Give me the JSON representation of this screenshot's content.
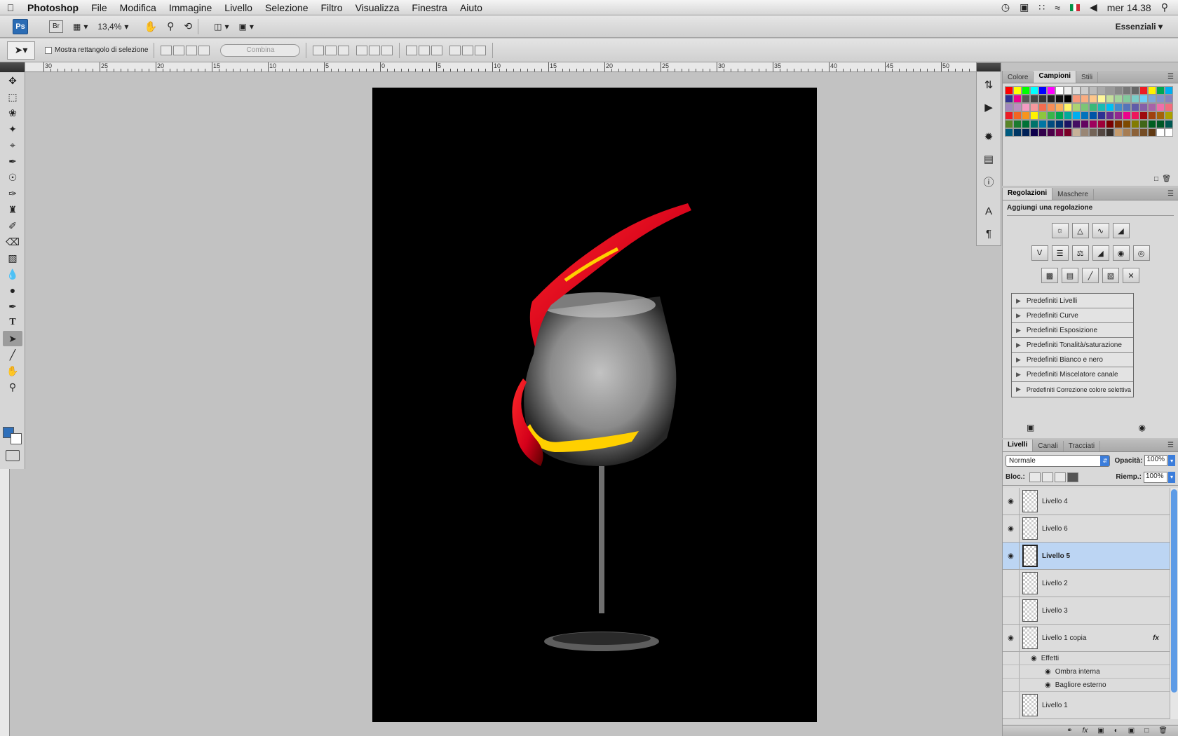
{
  "menubar": {
    "app": "Photoshop",
    "items": [
      "File",
      "Modifica",
      "Immagine",
      "Livello",
      "Selezione",
      "Filtro",
      "Visualizza",
      "Finestra",
      "Aiuto"
    ],
    "clock": "mer 14.38"
  },
  "appbar": {
    "ps": "Ps",
    "br": "Br",
    "zoom": "13,4%",
    "workspace": "Essenziali"
  },
  "options": {
    "show_transform": "Mostra rettangolo di selezione",
    "combine": "Combina"
  },
  "ruler": {
    "labels": [
      "30",
      "25",
      "20",
      "15",
      "10",
      "5",
      "0",
      "5",
      "10",
      "15",
      "20",
      "25",
      "30",
      "35",
      "40",
      "45",
      "50"
    ]
  },
  "swatches_panel": {
    "tabs": [
      "Colore",
      "Campioni",
      "Stili"
    ],
    "active_tab": "Campioni",
    "colors": [
      "#ff0000",
      "#ffff00",
      "#00ff00",
      "#00ffff",
      "#0000ff",
      "#ff00ff",
      "#ffffff",
      "#eeeeee",
      "#dddddd",
      "#cccccc",
      "#bbbbbb",
      "#aaaaaa",
      "#999999",
      "#888888",
      "#777777",
      "#666666",
      "#ed1c24",
      "#fff200",
      "#00a651",
      "#00aeef",
      "#2e3192",
      "#ec008c",
      "#555555",
      "#444444",
      "#333333",
      "#222222",
      "#111111",
      "#000000",
      "#f7977a",
      "#f9ad81",
      "#fdc68a",
      "#fff79a",
      "#c4df9b",
      "#a3d39c",
      "#82ca9d",
      "#7bcdc8",
      "#6ecff6",
      "#7ea7d8",
      "#8493ca",
      "#8882be",
      "#a187be",
      "#bc8dbf",
      "#f49ac2",
      "#f6989d",
      "#f26c4f",
      "#f68e56",
      "#fbaf5d",
      "#fff467",
      "#acd372",
      "#7cc576",
      "#3bb878",
      "#1abbb4",
      "#00bff3",
      "#438ccb",
      "#5574b9",
      "#605ca8",
      "#855fa8",
      "#a763a8",
      "#f06eaa",
      "#f26d7d",
      "#ed1c24",
      "#f26522",
      "#f7941d",
      "#fff200",
      "#8dc63f",
      "#39b54a",
      "#00a651",
      "#00a99d",
      "#00aeef",
      "#0072bc",
      "#0054a6",
      "#2e3192",
      "#662d91",
      "#92278f",
      "#ec008c",
      "#ed145b",
      "#9e0b0f",
      "#a0410d",
      "#a36209",
      "#aba000",
      "#598527",
      "#1a7b30",
      "#007236",
      "#00746b",
      "#0076a3",
      "#004b80",
      "#003471",
      "#1b1464",
      "#440e62",
      "#630460",
      "#9e005d",
      "#9e0039",
      "#790000",
      "#7b2e00",
      "#7d4900",
      "#827b00",
      "#406618",
      "#005e20",
      "#005826",
      "#005952",
      "#005b7f",
      "#003663",
      "#002157",
      "#0d004c",
      "#32004b",
      "#4b0049",
      "#7b0046",
      "#7a0026",
      "#c7b299",
      "#998675",
      "#736357",
      "#534741",
      "#37302a",
      "#c69c6d",
      "#a67c52",
      "#8c6239",
      "#754c24",
      "#603913",
      "#ffffff",
      "#ffffff"
    ]
  },
  "adjustments_panel": {
    "tabs": [
      "Regolazioni",
      "Maschere"
    ],
    "title": "Aggiungi una regolazione",
    "presets": [
      "Predefiniti Livelli",
      "Predefiniti Curve",
      "Predefiniti Esposizione",
      "Predefiniti Tonalità/saturazione",
      "Predefiniti Bianco e nero",
      "Predefiniti Miscelatore canale",
      "Predefiniti Correzione colore selettiva"
    ]
  },
  "layers_panel": {
    "tabs": [
      "Livelli",
      "Canali",
      "Tracciati"
    ],
    "blend_mode": "Normale",
    "opacity_label": "Opacità:",
    "opacity": "100%",
    "lock_label": "Bloc.:",
    "fill_label": "Riemp.:",
    "fill": "100%",
    "layers": [
      {
        "name": "Livello 4",
        "visible": true,
        "selected": false
      },
      {
        "name": "Livello 6",
        "visible": true,
        "selected": false
      },
      {
        "name": "Livello 5",
        "visible": true,
        "selected": true
      },
      {
        "name": "Livello 2",
        "visible": false,
        "selected": false
      },
      {
        "name": "Livello 3",
        "visible": false,
        "selected": false
      },
      {
        "name": "Livello 1 copia",
        "visible": true,
        "selected": false,
        "fx": "fx"
      },
      {
        "name": "Livello 1",
        "visible": false,
        "selected": false
      }
    ],
    "effects_label": "Effetti",
    "effects": [
      "Ombra interna",
      "Bagliore esterno"
    ]
  }
}
